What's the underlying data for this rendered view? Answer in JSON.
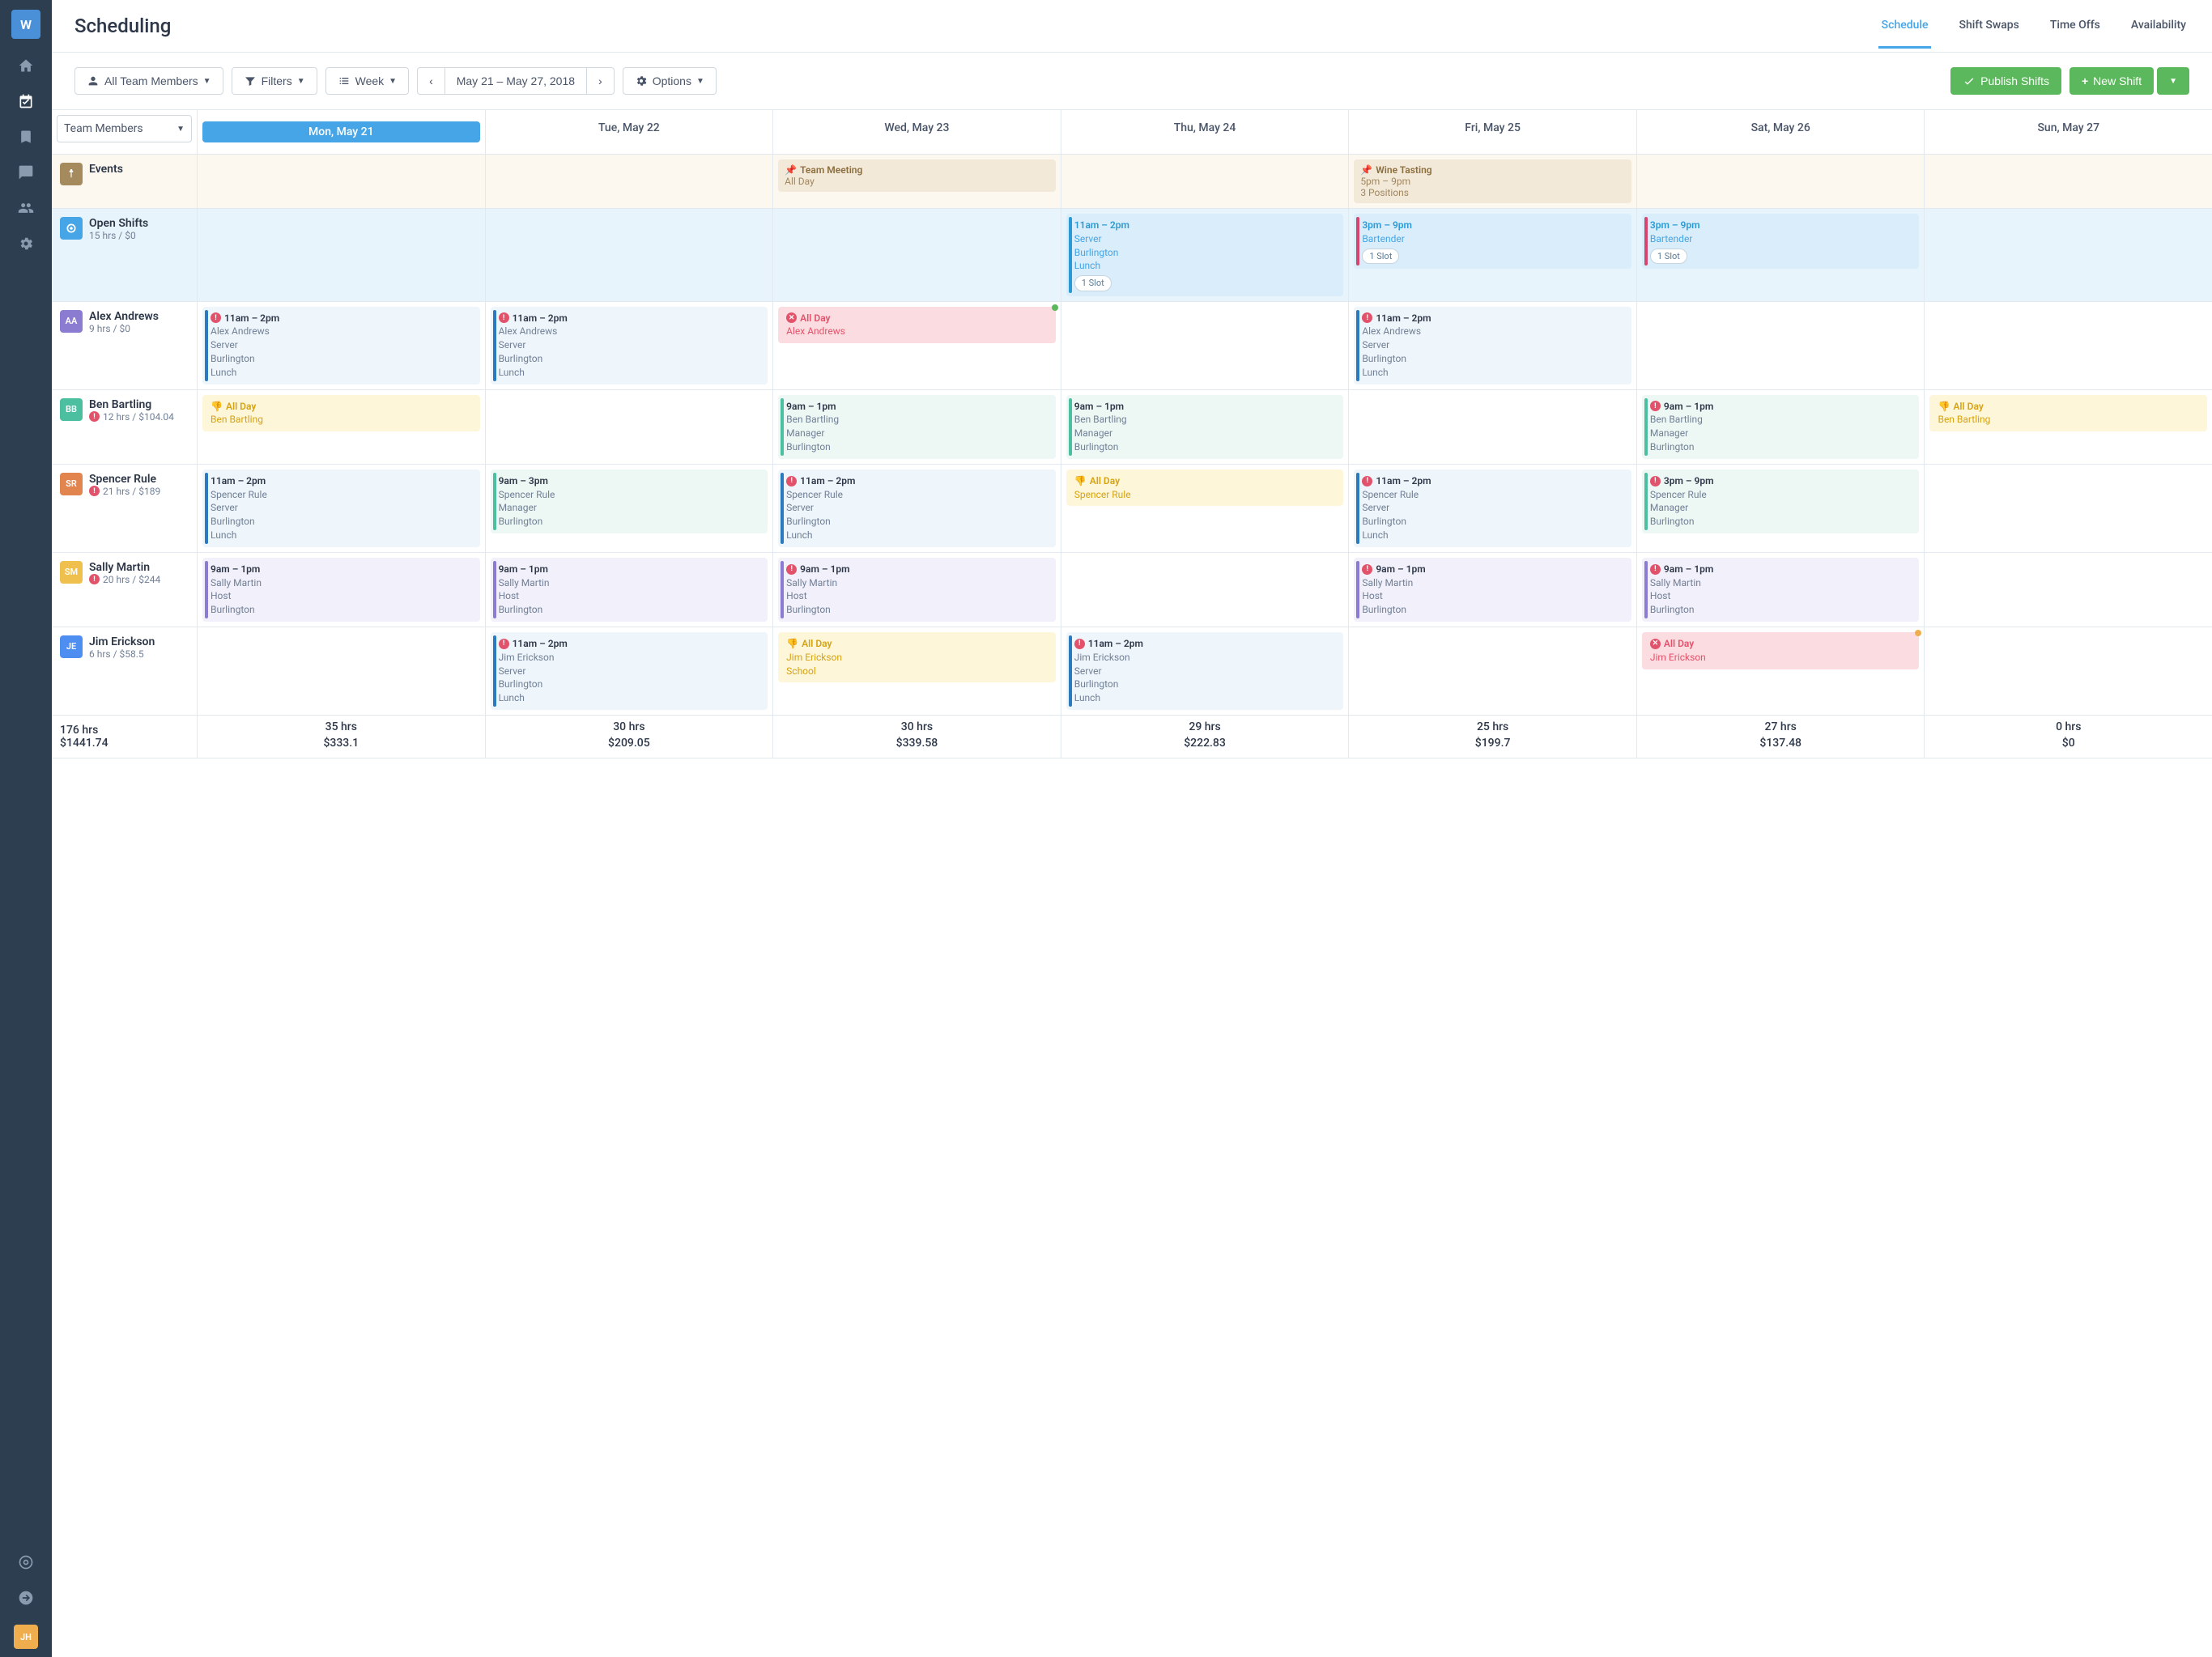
{
  "sidebar": {
    "logo": "W",
    "user_avatar": "JH"
  },
  "header": {
    "title": "Scheduling",
    "tabs": [
      {
        "label": "Schedule",
        "active": true
      },
      {
        "label": "Shift Swaps"
      },
      {
        "label": "Time Offs"
      },
      {
        "label": "Availability"
      }
    ]
  },
  "toolbar": {
    "team_filter": "All Team Members",
    "filters": "Filters",
    "view": "Week",
    "date_range": "May 21 – May 27, 2018",
    "options": "Options",
    "publish": "Publish Shifts",
    "new_shift": "New Shift"
  },
  "grid": {
    "group_selector": "Team Members",
    "days": [
      "Mon, May 21",
      "Tue, May 22",
      "Wed, May 23",
      "Thu, May 24",
      "Fri, May 25",
      "Sat, May 26",
      "Sun, May 27"
    ],
    "events_label": "Events",
    "events": {
      "wed": {
        "title": "Team Meeting",
        "sub": "All Day"
      },
      "fri": {
        "title": "Wine Tasting",
        "time": "5pm – 9pm",
        "positions": "3 Positions"
      }
    },
    "open": {
      "label": "Open Shifts",
      "sub": "15 hrs / $0",
      "thu": {
        "time": "11am – 2pm",
        "role": "Server",
        "loc": "Burlington",
        "meal": "Lunch",
        "slot": "1 Slot"
      },
      "fri": {
        "time": "3pm – 9pm",
        "role": "Bartender",
        "slot": "1 Slot"
      },
      "sat": {
        "time": "3pm – 9pm",
        "role": "Bartender",
        "slot": "1 Slot"
      }
    },
    "people": [
      {
        "initials": "AA",
        "color": "#8b7bd1",
        "name": "Alex Andrews",
        "sub": "9 hrs / $0",
        "cells": [
          {
            "style": "blue",
            "warn": true,
            "time": "11am – 2pm",
            "lines": [
              "Alex Andrews",
              "Server",
              "Burlington",
              "Lunch"
            ]
          },
          {
            "style": "blue",
            "warn": true,
            "time": "11am – 2pm",
            "lines": [
              "Alex Andrews",
              "Server",
              "Burlington",
              "Lunch"
            ]
          },
          {
            "style": "red",
            "close": true,
            "dot": "green",
            "time": "All Day",
            "lines": [
              "Alex Andrews"
            ]
          },
          null,
          {
            "style": "blue",
            "warn": true,
            "time": "11am – 2pm",
            "lines": [
              "Alex Andrews",
              "Server",
              "Burlington",
              "Lunch"
            ]
          },
          null,
          null
        ]
      },
      {
        "initials": "BB",
        "color": "#4bbfa0",
        "name": "Ben Bartling",
        "sub": "12 hrs / $104.04",
        "warn_sub": true,
        "cells": [
          {
            "style": "thumb",
            "time": "All Day",
            "lines": [
              "Ben Bartling"
            ]
          },
          null,
          {
            "style": "teal",
            "time": "9am – 1pm",
            "lines": [
              "Ben Bartling",
              "Manager",
              "Burlington"
            ]
          },
          {
            "style": "teal",
            "time": "9am – 1pm",
            "lines": [
              "Ben Bartling",
              "Manager",
              "Burlington"
            ]
          },
          null,
          {
            "style": "teal",
            "warn": true,
            "time": "9am – 1pm",
            "lines": [
              "Ben Bartling",
              "Manager",
              "Burlington"
            ]
          },
          {
            "style": "thumb",
            "time": "All Day",
            "lines": [
              "Ben Bartling"
            ]
          }
        ]
      },
      {
        "initials": "SR",
        "color": "#e2844e",
        "name": "Spencer Rule",
        "sub": "21 hrs / $189",
        "warn_sub": true,
        "cells": [
          {
            "style": "blue",
            "time": "11am – 2pm",
            "lines": [
              "Spencer Rule",
              "Server",
              "Burlington",
              "Lunch"
            ]
          },
          {
            "style": "teal",
            "time": "9am – 3pm",
            "lines": [
              "Spencer Rule",
              "Manager",
              "Burlington"
            ]
          },
          {
            "style": "blue",
            "warn": true,
            "time": "11am – 2pm",
            "lines": [
              "Spencer Rule",
              "Server",
              "Burlington",
              "Lunch"
            ]
          },
          {
            "style": "thumb",
            "time": "All Day",
            "lines": [
              "Spencer Rule"
            ]
          },
          {
            "style": "blue",
            "warn": true,
            "time": "11am – 2pm",
            "lines": [
              "Spencer Rule",
              "Server",
              "Burlington",
              "Lunch"
            ]
          },
          {
            "style": "teal",
            "warn": true,
            "time": "3pm – 9pm",
            "lines": [
              "Spencer Rule",
              "Manager",
              "Burlington"
            ]
          },
          null
        ]
      },
      {
        "initials": "SM",
        "color": "#f0c04e",
        "name": "Sally Martin",
        "sub": "20 hrs / $244",
        "warn_sub": true,
        "cells": [
          {
            "style": "purple",
            "time": "9am – 1pm",
            "lines": [
              "Sally Martin",
              "Host",
              "Burlington"
            ]
          },
          {
            "style": "purple",
            "time": "9am – 1pm",
            "lines": [
              "Sally Martin",
              "Host",
              "Burlington"
            ]
          },
          {
            "style": "purple",
            "warn": true,
            "time": "9am – 1pm",
            "lines": [
              "Sally Martin",
              "Host",
              "Burlington"
            ]
          },
          null,
          {
            "style": "purple",
            "warn": true,
            "time": "9am – 1pm",
            "lines": [
              "Sally Martin",
              "Host",
              "Burlington"
            ]
          },
          {
            "style": "purple",
            "warn": true,
            "time": "9am – 1pm",
            "lines": [
              "Sally Martin",
              "Host",
              "Burlington"
            ]
          },
          null
        ]
      },
      {
        "initials": "JE",
        "color": "#4e8ef0",
        "name": "Jim Erickson",
        "sub": "6 hrs / $58.5",
        "cells": [
          null,
          {
            "style": "blue",
            "warn": true,
            "time": "11am – 2pm",
            "lines": [
              "Jim Erickson",
              "Server",
              "Burlington",
              "Lunch"
            ]
          },
          {
            "style": "thumb",
            "time": "All Day",
            "lines": [
              "Jim Erickson",
              "School"
            ]
          },
          {
            "style": "blue",
            "warn": true,
            "time": "11am – 2pm",
            "lines": [
              "Jim Erickson",
              "Server",
              "Burlington",
              "Lunch"
            ]
          },
          null,
          {
            "style": "red",
            "close": true,
            "dot": "yellow",
            "time": "All Day",
            "lines": [
              "Jim Erickson"
            ]
          },
          null
        ]
      }
    ],
    "totals": {
      "label": {
        "hrs": "176 hrs",
        "amt": "$1441.74"
      },
      "days": [
        {
          "hrs": "35 hrs",
          "amt": "$333.1"
        },
        {
          "hrs": "30 hrs",
          "amt": "$209.05"
        },
        {
          "hrs": "30 hrs",
          "amt": "$339.58"
        },
        {
          "hrs": "29 hrs",
          "amt": "$222.83"
        },
        {
          "hrs": "25 hrs",
          "amt": "$199.7"
        },
        {
          "hrs": "27 hrs",
          "amt": "$137.48"
        },
        {
          "hrs": "0 hrs",
          "amt": "$0"
        }
      ]
    }
  }
}
